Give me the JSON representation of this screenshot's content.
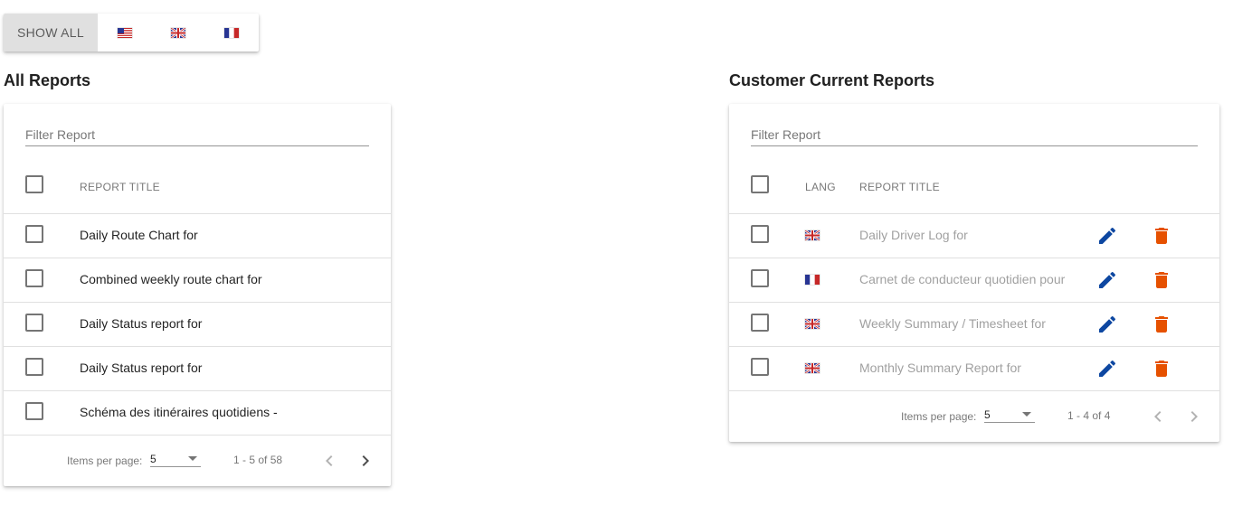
{
  "toolbar": {
    "show_all_label": "SHOW ALL",
    "flags": [
      "us-flag-icon",
      "gb-flag-icon",
      "fr-flag-icon"
    ]
  },
  "all_reports": {
    "title": "All Reports",
    "filter_placeholder": "Filter Report",
    "column_title": "REPORT TITLE",
    "rows": [
      {
        "title": "Daily Route Chart for"
      },
      {
        "title": "Combined weekly route chart for"
      },
      {
        "title": "Daily Status report for"
      },
      {
        "title": "Daily Status report for"
      },
      {
        "title": "Schéma des itinéraires quotidiens -"
      }
    ],
    "paginator": {
      "items_per_page_label": "Items per page:",
      "page_size": "5",
      "range_label": "1 - 5 of 58"
    }
  },
  "customer_reports": {
    "title": "Customer Current Reports",
    "filter_placeholder": "Filter Report",
    "column_lang": "LANG",
    "column_title": "REPORT TITLE",
    "rows": [
      {
        "lang": "gb",
        "title": "Daily Driver Log for"
      },
      {
        "lang": "fr",
        "title": "Carnet de conducteur quotidien pour"
      },
      {
        "lang": "gb",
        "title": "Weekly Summary / Timesheet for"
      },
      {
        "lang": "gb",
        "title": "Monthly Summary Report for"
      }
    ],
    "paginator": {
      "items_per_page_label": "Items per page:",
      "page_size": "5",
      "range_label": "1 - 4 of 4"
    }
  },
  "colors": {
    "edit": "#0d47a1",
    "delete": "#e65100",
    "toggle_selected": "#e0e0e0"
  }
}
